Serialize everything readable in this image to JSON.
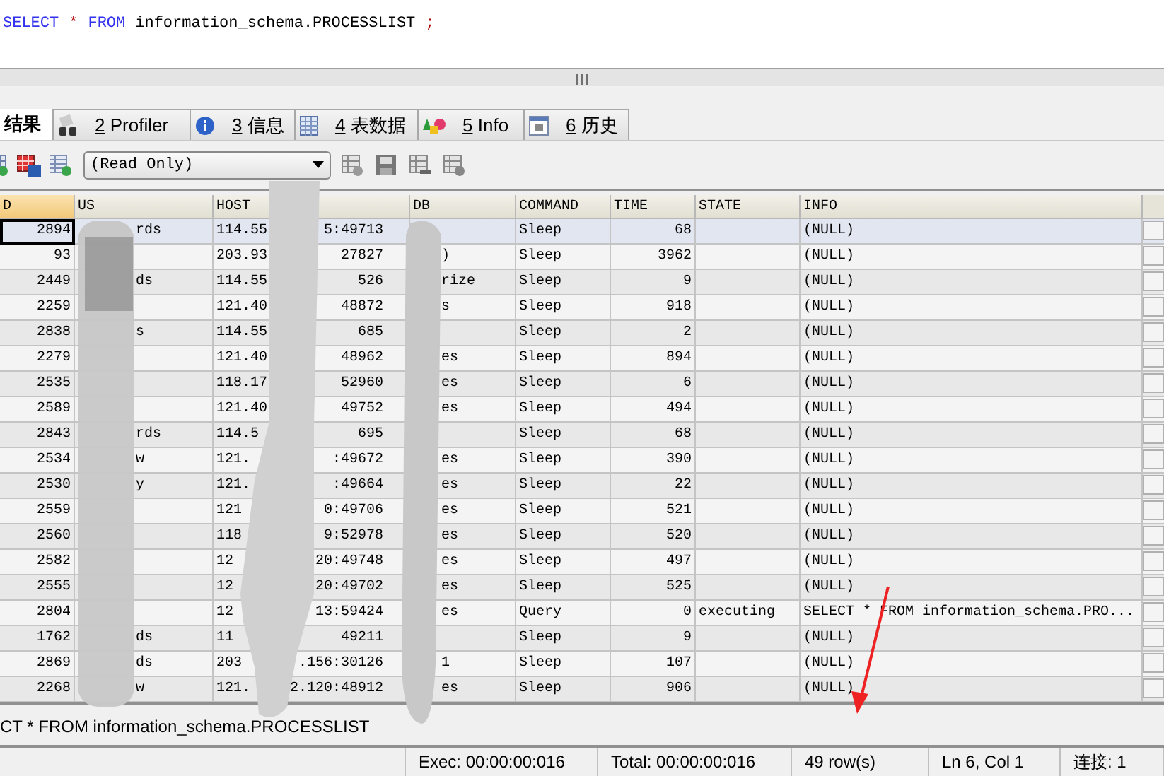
{
  "editor": {
    "query": [
      {
        "kind": "keyword",
        "text": "SELECT"
      },
      {
        "kind": "operator",
        "text": "*"
      },
      {
        "kind": "keyword",
        "text": "FROM"
      },
      {
        "kind": "identifier",
        "text": "information_schema.PROCESSLIST"
      },
      {
        "kind": "operator",
        "text": ";"
      }
    ]
  },
  "result_tabs": [
    {
      "kind": "plain",
      "label": "结果",
      "selected": true
    },
    {
      "kind": "profiler",
      "key": "2",
      "label": "Profiler",
      "selected": false
    },
    {
      "kind": "messages",
      "key": "3",
      "label": "信息",
      "selected": false
    },
    {
      "kind": "tabledata",
      "key": "4",
      "label": "表数据",
      "selected": false
    },
    {
      "kind": "info",
      "key": "5",
      "label": "Info",
      "selected": false
    },
    {
      "kind": "history",
      "key": "6",
      "label": "历史",
      "selected": false
    }
  ],
  "toolbar": {
    "mode_select": {
      "value": "(Read Only)"
    }
  },
  "grid": {
    "columns": [
      "D",
      "US",
      "HOST",
      "DB",
      "COMMAND",
      "TIME",
      "STATE",
      "INFO"
    ],
    "rows": [
      {
        "id": "2894",
        "user": "rds",
        "host_start": "114.55",
        "host_end": "5:49713",
        "command": "Sleep",
        "time": "68",
        "info": "(NULL)",
        "selected": true
      },
      {
        "id": "93",
        "host_start": "203.93",
        "host_end": "27827",
        "db": ")",
        "command": "Sleep",
        "time": "3962",
        "info": "(NULL)",
        "selected": false
      },
      {
        "id": "2449",
        "user": "ds",
        "host_start": "114.55",
        "host_end": "526",
        "db": "rize",
        "command": "Sleep",
        "time": "9",
        "info": "(NULL)",
        "selected": false
      },
      {
        "id": "2259",
        "host_start": "121.40",
        "host_end": "48872",
        "db": "s",
        "command": "Sleep",
        "time": "918",
        "info": "(NULL)",
        "selected": false
      },
      {
        "id": "2838",
        "user": "s",
        "host_start": "114.55",
        "host_end": "685",
        "command": "Sleep",
        "time": "2",
        "info": "(NULL)",
        "selected": false
      },
      {
        "id": "2279",
        "host_start": "121.40",
        "host_end": "48962",
        "db": "es",
        "command": "Sleep",
        "time": "894",
        "info": "(NULL)",
        "selected": false
      },
      {
        "id": "2535",
        "host_start": "118.17",
        "host_end": "52960",
        "db": "es",
        "command": "Sleep",
        "time": "6",
        "info": "(NULL)",
        "selected": false
      },
      {
        "id": "2589",
        "host_start": "121.40",
        "host_end": "49752",
        "db": "es",
        "command": "Sleep",
        "time": "494",
        "info": "(NULL)",
        "selected": false
      },
      {
        "id": "2843",
        "user": "rds",
        "host_start": "114.5",
        "host_end": "695",
        "command": "Sleep",
        "time": "68",
        "info": "(NULL)",
        "selected": false
      },
      {
        "id": "2534",
        "user": "w",
        "host_start": "121.",
        "host_end": ":49672",
        "db": "es",
        "command": "Sleep",
        "time": "390",
        "info": "(NULL)",
        "selected": false
      },
      {
        "id": "2530",
        "user": "y",
        "host_start": "121.",
        "host_end": ":49664",
        "db": "es",
        "command": "Sleep",
        "time": "22",
        "info": "(NULL)",
        "selected": false
      },
      {
        "id": "2559",
        "host_start": "121",
        "host_end": "0:49706",
        "db": "es",
        "command": "Sleep",
        "time": "521",
        "info": "(NULL)",
        "selected": false
      },
      {
        "id": "2560",
        "host_start": "118",
        "host_end": "9:52978",
        "db": "es",
        "command": "Sleep",
        "time": "520",
        "info": "(NULL)",
        "selected": false
      },
      {
        "id": "2582",
        "host_start": "12",
        "host_end": "20:49748",
        "db": "es",
        "command": "Sleep",
        "time": "497",
        "info": "(NULL)",
        "selected": false
      },
      {
        "id": "2555",
        "host_start": "12",
        "host_end": "20:49702",
        "db": "es",
        "command": "Sleep",
        "time": "525",
        "info": "(NULL)",
        "selected": false
      },
      {
        "id": "2804",
        "host_start": "12",
        "host_end": "13:59424",
        "db": "es",
        "command": "Query",
        "time": "0",
        "state": "executing",
        "info": "SELECT * FROM information_schema.PRO...",
        "selected": false
      },
      {
        "id": "1762",
        "user": "ds",
        "host_start": "11",
        "host_end": "49211",
        "command": "Sleep",
        "time": "9",
        "info": "(NULL)",
        "selected": false
      },
      {
        "id": "2869",
        "user": "ds",
        "host_start": "203",
        "host_end": ".156:30126",
        "db": "1",
        "command": "Sleep",
        "time": "107",
        "info": "(NULL)",
        "selected": false
      },
      {
        "id": "2268",
        "user": "w",
        "host_start": "121.",
        "host_end": "2.120:48912",
        "db": "es",
        "command": "Sleep",
        "time": "906",
        "info": "(NULL)",
        "selected": false
      }
    ]
  },
  "message": "CT * FROM information_schema.PROCESSLIST",
  "status_bar": [
    "Exec: 00:00:00:016",
    "Total: 00:00:00:016",
    "49 row(s)",
    "Ln 6, Col 1",
    "连接: 1"
  ]
}
